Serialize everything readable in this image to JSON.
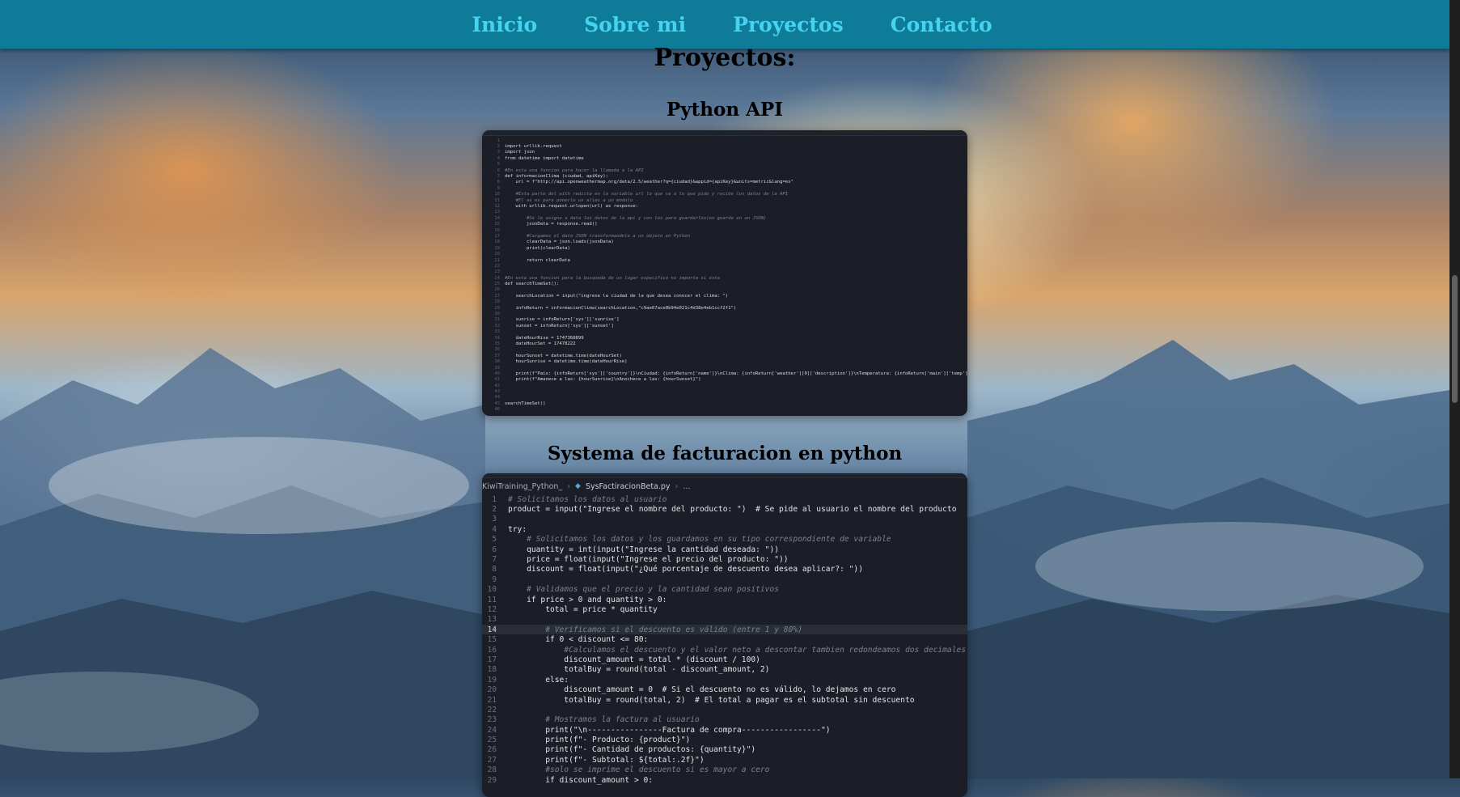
{
  "nav": {
    "items": [
      "Inicio",
      "Sobre mi",
      "Proyectos",
      "Contacto"
    ]
  },
  "page": {
    "title": "Proyectos:"
  },
  "projects": [
    {
      "title": "Python API",
      "code_lines": [
        "",
        "import urllib.request",
        "import json",
        "from datetime import datetime",
        "",
        "#En esta una funcion para hacer la llamada a la API",
        "def informacionClima (ciudad, apiKey):",
        "    url = f\"http://api.openweathermap.org/data/2.5/weather?q={ciudad}&appid={apiKey}&units=metric&lang=es\"",
        "",
        "    #Esta parte del with redicta en la variable url lo que va a lo que pide y recibe los datos de la API",
        "    #El as es para ponerle un alias a un modulo",
        "    with urllib.request.urlopen(url) as response:",
        "",
        "        #Se le asigna a data los datos de la api y con los para guardarlos(en guarda en un JSON)",
        "        jsonData = response.read()",
        "",
        "        #Cargamos el data JSON transformandolo a un objeto en Python",
        "        clearData = json.loads(jsonData)",
        "        print(clearData)",
        "",
        "        return clearData",
        "",
        "",
        "#En esta una funcion para la busqueda de un lugar especifico no importa si esta",
        "def searchTimeSet():",
        "",
        "    searchLocation = input(\"ingrese la ciudad de la que desea conocer el clima: \")",
        "",
        "    infoReturn = informacionClima(searchLocation,\"c9ae67ace0b94e021c4d38e4eb1ccf2f1\")",
        "",
        "    sunrise = infoReturn['sys']['sunrise']",
        "    sunset = infoReturn['sys']['sunset']",
        "",
        "    dateHourRise = 1747368899",
        "    dateHourSet = 17478222",
        "",
        "    hourSunset = datetime.time(dateHourSet)",
        "    hourSunrise = datetime.time(dateHourRise)",
        "",
        "    print(f\"Pais: {infoReturn['sys']['country']}\\nCiudad: {infoReturn['name']}\\nClima: {infoReturn['weather'][0]['description']}\\nTemperatura: {infoReturn['main']['temp']}\")",
        "    print(f\"Amanece a las: {hourSunrise}\\nAnochece a las: {hourSunset}\")",
        "",
        "",
        "",
        "searchTimeSet()",
        ""
      ]
    },
    {
      "title": "Systema de facturacion en python",
      "breadcrumb": {
        "folder": "KiwiTraining_Python_",
        "file": "SysFactiracionBeta.py",
        "trail": "..."
      },
      "code_lines": [
        {
          "n": "1",
          "t": "# Solicitamos los datos al usuario"
        },
        {
          "n": "2",
          "t": "product = input(\"Ingrese el nombre del producto: \")  # Se pide al usuario el nombre del producto"
        },
        {
          "n": "3",
          "t": ""
        },
        {
          "n": "4",
          "t": "try:"
        },
        {
          "n": "5",
          "t": "    # Solicitamos los datos y los guardamos en su tipo correspondiente de variable"
        },
        {
          "n": "6",
          "t": "    quantity = int(input(\"Ingrese la cantidad deseada: \"))"
        },
        {
          "n": "7",
          "t": "    price = float(input(\"Ingrese el precio del producto: \"))"
        },
        {
          "n": "8",
          "t": "    discount = float(input(\"¿Qué porcentaje de descuento desea aplicar?: \"))"
        },
        {
          "n": "9",
          "t": ""
        },
        {
          "n": "10",
          "t": "    # Validamos que el precio y la cantidad sean positivos"
        },
        {
          "n": "11",
          "t": "    if price > 0 and quantity > 0:"
        },
        {
          "n": "12",
          "t": "        total = price * quantity"
        },
        {
          "n": "13",
          "t": ""
        },
        {
          "n": "14",
          "t": "        # Verificamos si el descuento es válido (entre 1 y 80%)"
        },
        {
          "n": "15",
          "t": "        if 0 < discount <= 80:"
        },
        {
          "n": "16",
          "t": "            #Calculamos el descuento y el valor neto a descontar tambien redondeamos dos decimales"
        },
        {
          "n": "17",
          "t": "            discount_amount = total * (discount / 100)"
        },
        {
          "n": "18",
          "t": "            totalBuy = round(total - discount_amount, 2)"
        },
        {
          "n": "19",
          "t": "        else:"
        },
        {
          "n": "20",
          "t": "            discount_amount = 0  # Si el descuento no es válido, lo dejamos en cero"
        },
        {
          "n": "21",
          "t": "            totalBuy = round(total, 2)  # El total a pagar es el subtotal sin descuento"
        },
        {
          "n": "22",
          "t": ""
        },
        {
          "n": "23",
          "t": "        # Mostramos la factura al usuario"
        },
        {
          "n": "24",
          "t": "        print(\"\\n----------------Factura de compra-----------------\")"
        },
        {
          "n": "25",
          "t": "        print(f\"- Producto: {product}\")"
        },
        {
          "n": "26",
          "t": "        print(f\"- Cantidad de productos: {quantity}\")"
        },
        {
          "n": "27",
          "t": "        print(f\"- Subtotal: ${total:.2f}\")"
        },
        {
          "n": "28",
          "t": "        #solo se imprime el descuento si es mayor a cero"
        },
        {
          "n": "29",
          "t": "        if discount_amount > 0:"
        }
      ],
      "highlighted_line": "14"
    }
  ],
  "colors": {
    "nav_bg": "#0e7c99",
    "nav_link": "#47d2ef",
    "code_bg": "#1b1e26"
  }
}
